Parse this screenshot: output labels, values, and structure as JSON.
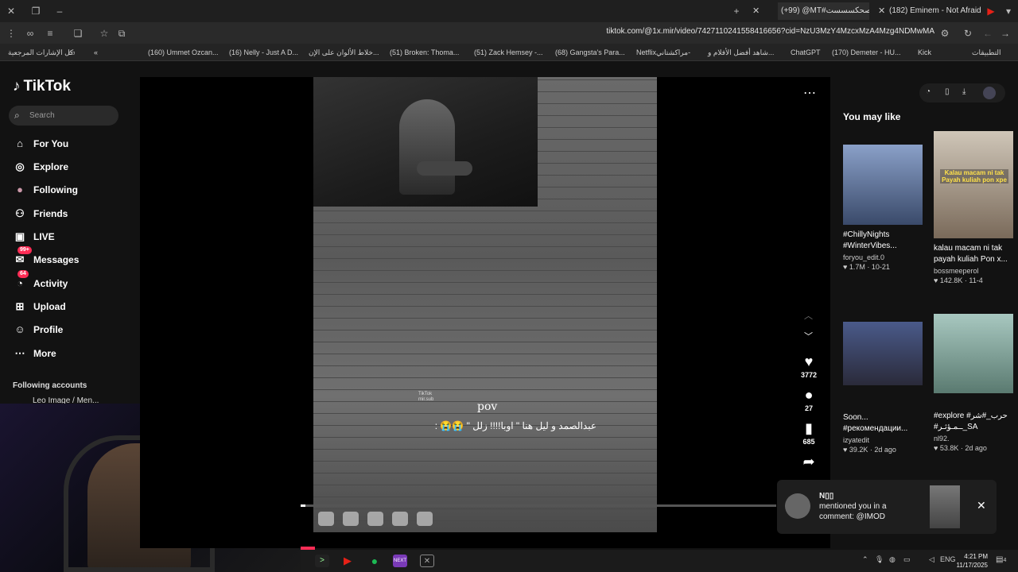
{
  "browser": {
    "tabs": [
      {
        "label": "(+99) @MT#صحكسسست"
      },
      {
        "label": "(182) Eminem - Not Afraid (Re"
      }
    ],
    "url": "tiktok.com/@1x.mir/video/7427110241558416656?cid=NzU3MzY4MzcxMzA4Mzg4NDMwMA",
    "bookmarks": [
      "كل الإشارات المرجعية",
      "(160) Ummet Ozcan...",
      "(16) Nelly - Just A D...",
      "خلاط الألوان على الإن...",
      "(51) Broken: Thoma...",
      "(51) Zack Hemsey -...",
      "(68) Gangsta's Para...",
      "Netflixمراكشتاني-",
      "شاهد أفضل الأفلام و...",
      "ChatGPT",
      "(170) Demeter - HU...",
      "Kick",
      "التطبيقات"
    ]
  },
  "sidebar": {
    "logo": "TikTok",
    "search_placeholder": "Search",
    "items": [
      {
        "label": "For You",
        "icon": "home-icon"
      },
      {
        "label": "Explore",
        "icon": "compass-icon"
      },
      {
        "label": "Following",
        "icon": "avatar-icon"
      },
      {
        "label": "Friends",
        "icon": "friends-icon"
      },
      {
        "label": "LIVE",
        "icon": "live-icon"
      },
      {
        "label": "Messages",
        "icon": "messages-icon",
        "badge": "99+"
      },
      {
        "label": "Activity",
        "icon": "activity-icon",
        "badge": "64"
      },
      {
        "label": "Upload",
        "icon": "upload-icon"
      },
      {
        "label": "Profile",
        "icon": "profile-icon"
      },
      {
        "label": "More",
        "icon": "more-icon"
      }
    ],
    "following_accounts_label": "Following accounts",
    "first_account": "Leo Image / Men..."
  },
  "video": {
    "pov": "pov",
    "caption": "عبدالصمد و ليل هنا \" اوبا!!!! زلل \" 😭😭 :",
    "watermark": "TikTok\nmir.sub",
    "likes": "3772",
    "comments": "27",
    "saves": "685"
  },
  "right_panel": {
    "title": "You may like",
    "cards": [
      {
        "title": "#ChillyNights #WinterVibes...",
        "user": "foryou_edit.0",
        "stats": "♥ 1.7M · 10-21"
      },
      {
        "title": "kalau macam ni tak payah kuliah Pon x...",
        "user": "bossmeeperol",
        "stats": "♥ 142.8K · 11-4",
        "overlay": "Kalau macam ni tak Payah kuliah pon xpe"
      },
      {
        "title": "Soon... #рекомендации...",
        "user": "izyatedit",
        "stats": "♥ 39.2K · 2d ago"
      },
      {
        "title": "#explore #حرب_#شر",
        "user": "nl92.",
        "stats": "♥ 53.8K · 2d ago",
        "subtitle": "#ــمـؤثـر_SA"
      }
    ]
  },
  "notification": {
    "name": "N▯▯",
    "line1": "mentioned you in a",
    "line2": "comment: @IMOD"
  },
  "taskbar": {
    "time": "4:21 PM",
    "date": "11/17/2025",
    "lang": "ENG",
    "notif_count": "4"
  },
  "colors": {
    "accent": "#fe2c55",
    "teal": "#25f4ee"
  }
}
